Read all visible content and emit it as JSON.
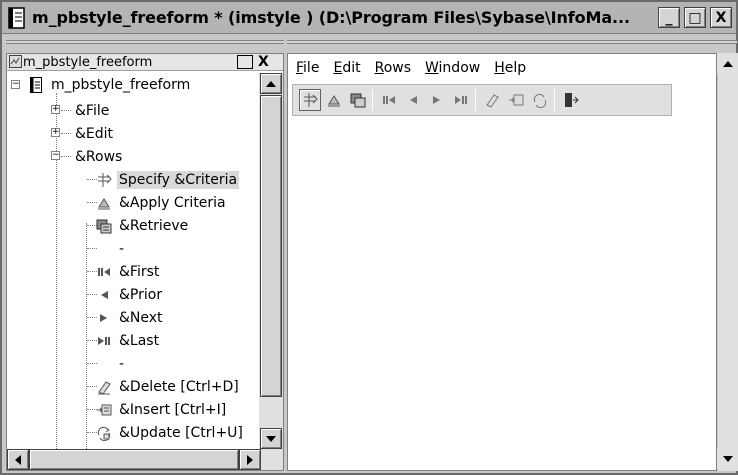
{
  "window": {
    "title": "m_pbstyle_freeform * (imstyle ) (D:\\Program Files\\Sybase\\InfoMa...",
    "minimize_label": "_",
    "maximize_label": "□",
    "close_label": "X"
  },
  "tree_pane": {
    "header_label": "m_pbstyle_freeform",
    "close_label": "X",
    "root_label": "m_pbstyle_freeform",
    "items": [
      {
        "label": "&File",
        "icon": "none"
      },
      {
        "label": "&Edit",
        "icon": "none"
      },
      {
        "label": "&Rows",
        "icon": "none"
      },
      {
        "label": "Specify &Criteria",
        "icon": "specify-criteria-icon"
      },
      {
        "label": "&Apply Criteria",
        "icon": "apply-criteria-icon"
      },
      {
        "label": "&Retrieve",
        "icon": "retrieve-icon"
      },
      {
        "label": "-",
        "icon": "none"
      },
      {
        "label": "&First",
        "icon": "first-icon"
      },
      {
        "label": "&Prior",
        "icon": "prior-icon"
      },
      {
        "label": "&Next",
        "icon": "next-icon"
      },
      {
        "label": "&Last",
        "icon": "last-icon"
      },
      {
        "label": "-",
        "icon": "none"
      },
      {
        "label": "&Delete  [Ctrl+D]",
        "icon": "delete-icon"
      },
      {
        "label": "&Insert  [Ctrl+I]",
        "icon": "insert-icon"
      },
      {
        "label": "&Update  [Ctrl+U]",
        "icon": "update-icon"
      }
    ]
  },
  "preview": {
    "menu": {
      "file": {
        "hot": "F",
        "rest": "ile"
      },
      "edit": {
        "hot": "E",
        "rest": "dit"
      },
      "rows": {
        "hot": "R",
        "rest": "ows"
      },
      "window": {
        "pre": "",
        "hot": "W",
        "rest": "indow"
      },
      "help": {
        "hot": "H",
        "rest": "elp"
      }
    }
  }
}
